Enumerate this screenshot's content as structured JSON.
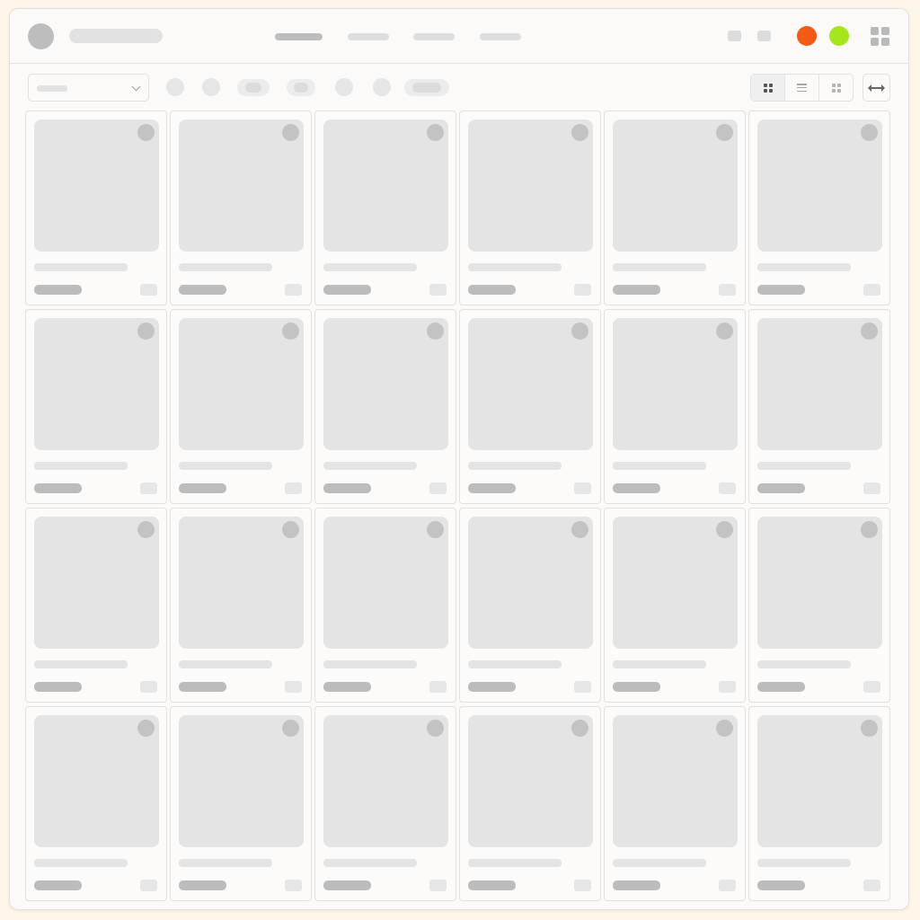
{
  "header": {
    "nav_items": [
      "",
      "",
      "",
      ""
    ],
    "active_nav_index": 0
  },
  "toolbar": {
    "dropdown_value": "",
    "active_view": "grid-view"
  },
  "status_colors": {
    "orange": "#f45a14",
    "green": "#a4e81c"
  },
  "icons": {
    "apps": "apps-grid-icon",
    "dropdown": "chevron-down-icon",
    "grid_view": "grid-view-icon",
    "list_view": "list-view-icon",
    "compact_view": "compact-grid-icon",
    "resize": "horizontal-resize-icon",
    "favorite": "favorite-icon"
  },
  "grid": {
    "columns": 6,
    "rows": 4,
    "cards": [
      {
        "title": "",
        "price": ""
      },
      {
        "title": "",
        "price": ""
      },
      {
        "title": "",
        "price": ""
      },
      {
        "title": "",
        "price": ""
      },
      {
        "title": "",
        "price": ""
      },
      {
        "title": "",
        "price": ""
      },
      {
        "title": "",
        "price": ""
      },
      {
        "title": "",
        "price": ""
      },
      {
        "title": "",
        "price": ""
      },
      {
        "title": "",
        "price": ""
      },
      {
        "title": "",
        "price": ""
      },
      {
        "title": "",
        "price": ""
      },
      {
        "title": "",
        "price": ""
      },
      {
        "title": "",
        "price": ""
      },
      {
        "title": "",
        "price": ""
      },
      {
        "title": "",
        "price": ""
      },
      {
        "title": "",
        "price": ""
      },
      {
        "title": "",
        "price": ""
      },
      {
        "title": "",
        "price": ""
      },
      {
        "title": "",
        "price": ""
      },
      {
        "title": "",
        "price": ""
      },
      {
        "title": "",
        "price": ""
      },
      {
        "title": "",
        "price": ""
      },
      {
        "title": "",
        "price": ""
      }
    ]
  }
}
